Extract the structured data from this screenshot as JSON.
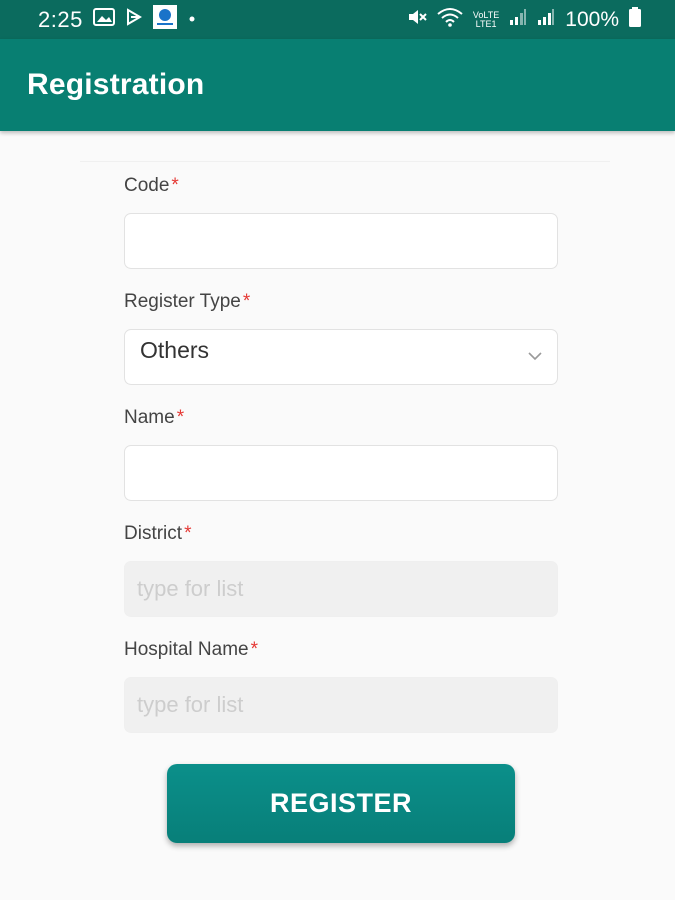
{
  "status_bar": {
    "time": "2:25",
    "battery_percent": "100%",
    "network_label": "LTE1",
    "icons": [
      "gallery-icon",
      "download-icon",
      "app-notification-icon",
      "dot-icon",
      "mute-icon",
      "wifi-icon",
      "volte-icon",
      "signal-icon",
      "signal-icon",
      "battery-icon"
    ]
  },
  "app_bar": {
    "title": "Registration"
  },
  "form": {
    "code": {
      "label": "Code",
      "required_mark": "*",
      "value": ""
    },
    "register_type": {
      "label": "Register Type",
      "required_mark": "*",
      "selected": "Others"
    },
    "name": {
      "label": "Name",
      "required_mark": "*",
      "value": ""
    },
    "district": {
      "label": "District",
      "required_mark": "*",
      "placeholder": "type for list"
    },
    "hospital_name": {
      "label": "Hospital Name",
      "required_mark": "*",
      "placeholder": "type for list"
    }
  },
  "register_button": {
    "label": "REGISTER"
  },
  "colors": {
    "status_bar": "#0b6b5e",
    "app_bar": "#087f72",
    "button": "#0b8a84",
    "required": "#e53935"
  }
}
